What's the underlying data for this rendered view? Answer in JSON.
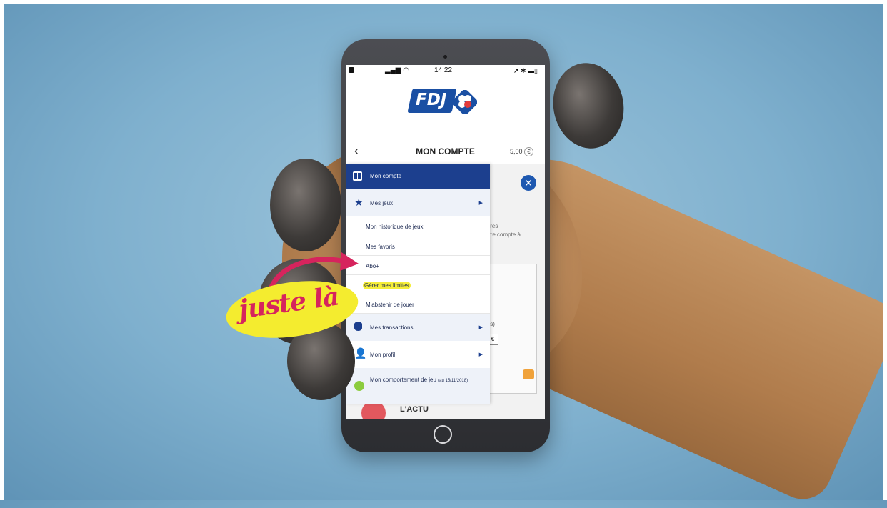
{
  "status_bar": {
    "time": "14:22"
  },
  "brand": {
    "logo_text": "FDJ"
  },
  "header": {
    "title": "MON COMPTE",
    "balance": "5,00",
    "currency_symbol": "€"
  },
  "menu": {
    "account_label": "Mon compte",
    "items": [
      {
        "label": "Mes jeux",
        "icon": "star-icon"
      },
      {
        "label": "Mon historique de jeux"
      },
      {
        "label": "Mes favoris"
      },
      {
        "label": "Abo+"
      },
      {
        "label": "Gérer mes limites"
      },
      {
        "label": "M'abstenir de jouer"
      },
      {
        "label": "Mes transactions",
        "icon": "coins-icon"
      },
      {
        "label": "Mon profil",
        "icon": "person-icon"
      },
      {
        "label": "Mon comportement de jeu",
        "date_note": "(au 15/11/2018)",
        "icon": "status-dot-icon"
      }
    ]
  },
  "background_page": {
    "text_line1": "ières",
    "text_line2": "otre compte à",
    "partial_label": "els)",
    "euro": "€",
    "section_title": "L'ACTU"
  },
  "annotation": {
    "text": "juste là"
  },
  "colors": {
    "brand_blue": "#1c3f8e",
    "highlight": "#f5ee38",
    "annotation_pink": "#d6245d"
  }
}
